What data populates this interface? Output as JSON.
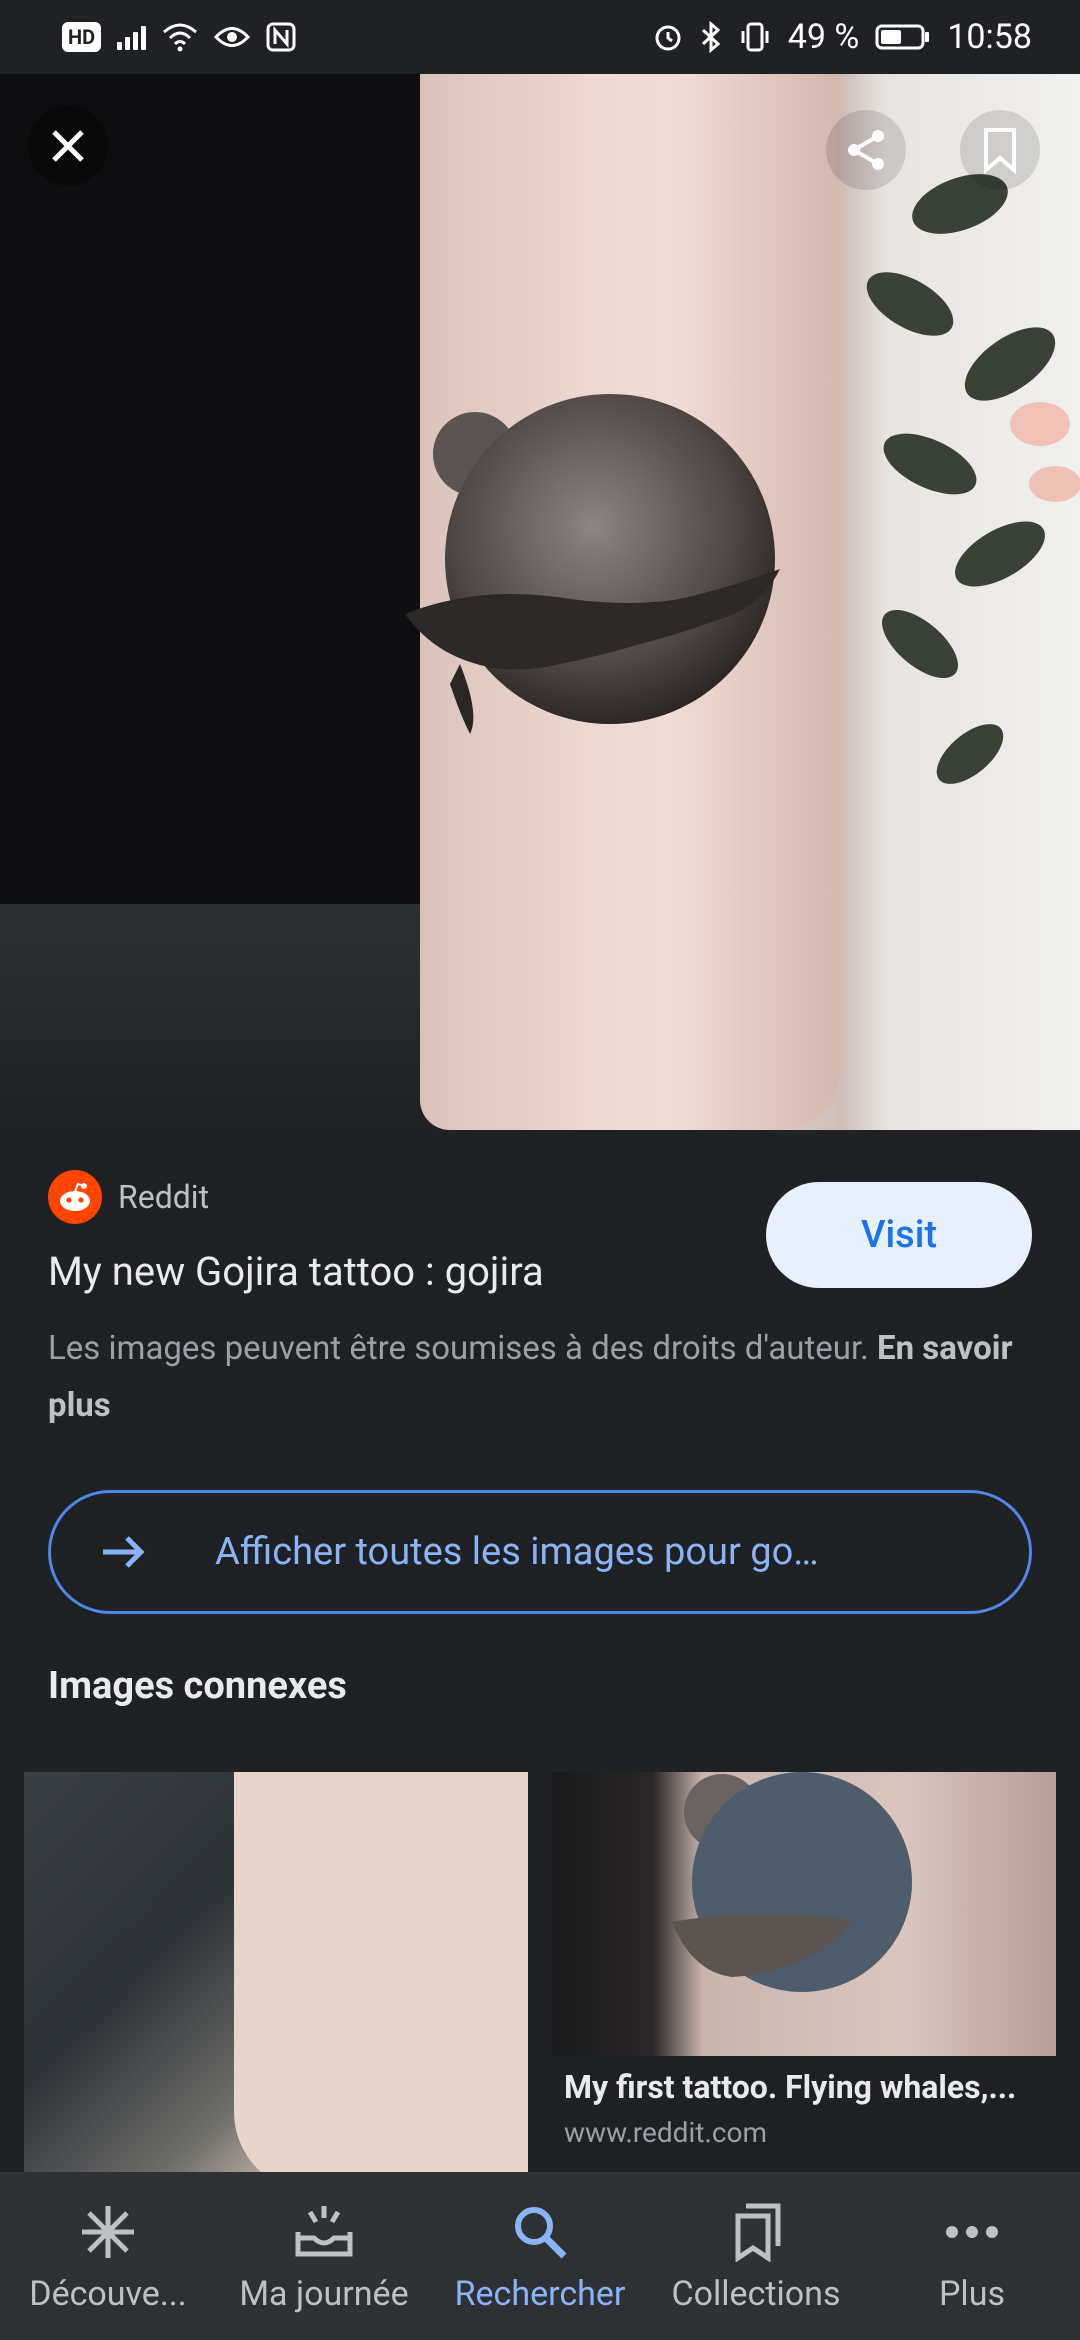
{
  "status": {
    "battery_percent": "49 %",
    "time": "10:58",
    "hd": "HD"
  },
  "viewer": {
    "close_label": "Close",
    "share_label": "Share",
    "save_label": "Save"
  },
  "result": {
    "source_name": "Reddit",
    "title": "My new Gojira tattoo : gojira",
    "visit_label": "Visit",
    "rights_text": "Les images peuvent être soumises à des droits d'auteur.",
    "rights_link": "En savoir plus"
  },
  "all_images_button": "Afficher toutes les images pour go…",
  "related": {
    "title": "Images connexes",
    "items": [
      {
        "caption": "",
        "url": ""
      },
      {
        "caption": "My first tattoo. Flying whales,...",
        "url": "www.reddit.com"
      }
    ]
  },
  "nav": {
    "items": [
      {
        "label": "Découve...",
        "icon": "asterisk-icon"
      },
      {
        "label": "Ma journée",
        "icon": "inbox-icon"
      },
      {
        "label": "Rechercher",
        "icon": "search-icon"
      },
      {
        "label": "Collections",
        "icon": "collections-icon"
      },
      {
        "label": "Plus",
        "icon": "more-icon"
      }
    ],
    "active_index": 2
  }
}
